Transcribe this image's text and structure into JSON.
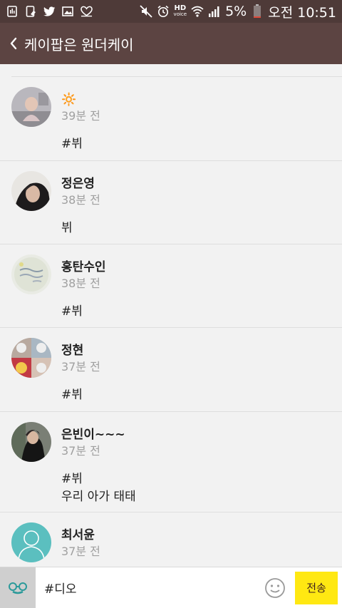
{
  "statusbar": {
    "battery": "5%",
    "time": "오전 10:51",
    "hd_label": "HD",
    "voice_label": "voice",
    "left_icons": [
      "notification-icon",
      "file-icon",
      "twitter-icon",
      "image-icon",
      "heart-icon"
    ]
  },
  "header": {
    "title": "케이팝은 원더케이"
  },
  "comments": [
    {
      "name": "",
      "name_emoji": "🔆",
      "time": "39분 전",
      "lines": [
        "#뷔"
      ]
    },
    {
      "name": "정은영",
      "time": "38분 전",
      "lines": [
        "뷔"
      ]
    },
    {
      "name": "홍탄수인",
      "time": "38분 전",
      "lines": [
        "#뷔"
      ]
    },
    {
      "name": "정현",
      "time": "37분 전",
      "lines": [
        "#뷔"
      ]
    },
    {
      "name": "은빈이~~~",
      "time": "37분 전",
      "lines": [
        "#뷔",
        "우리 아가 태태"
      ]
    },
    {
      "name": "최서윤",
      "time": "37분 전",
      "lines": []
    }
  ],
  "input": {
    "value": "#디오",
    "send_label": "전송"
  },
  "colors": {
    "statusbar": "#4e3a38",
    "header": "#5c4442",
    "send_button": "#ffe812",
    "default_avatar": "#5bbfbf"
  }
}
